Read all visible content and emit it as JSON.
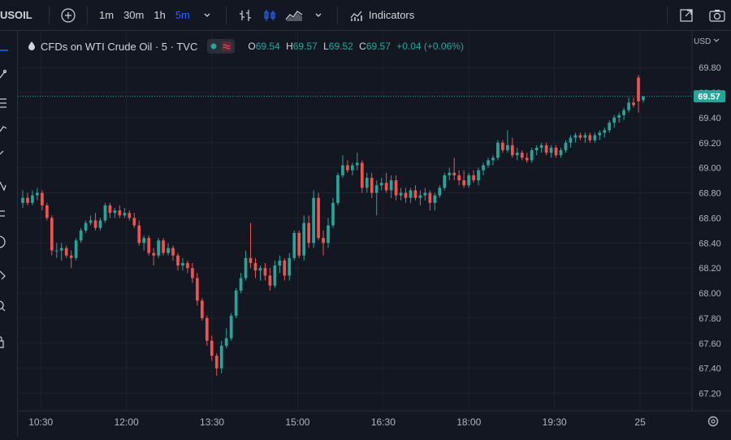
{
  "toolbar": {
    "symbol": "USOIL",
    "intervals": [
      "1m",
      "30m",
      "1h",
      "5m"
    ],
    "active_interval": "5m",
    "indicators_label": "Indicators"
  },
  "legend": {
    "title": "CFDs on WTI Crude Oil · 5 · TVC",
    "o_label": "O",
    "o": "69.54",
    "h_label": "H",
    "h": "69.57",
    "l_label": "L",
    "l": "69.52",
    "c_label": "C",
    "c": "69.57",
    "change": "+0.04 (+0.06%)"
  },
  "price_axis": {
    "currency": "USD"
  },
  "colors": {
    "up": "#26a69a",
    "down": "#ef5350",
    "background": "#131722",
    "grid": "#1e222d",
    "text": "#b2b5be",
    "accent": "#2962ff"
  },
  "chart_data": {
    "type": "candlestick",
    "ylim": [
      67.1,
      69.95
    ],
    "y_ticks": [
      67.2,
      67.4,
      67.6,
      67.8,
      68.0,
      68.2,
      68.4,
      68.6,
      68.8,
      69.0,
      69.2,
      69.4,
      69.6,
      69.8
    ],
    "x_ticks": [
      "10:30",
      "12:00",
      "13:30",
      "15:00",
      "16:30",
      "18:00",
      "19:30",
      "25"
    ],
    "last_price": "69.57",
    "candles": [
      {
        "o": 68.72,
        "h": 68.82,
        "l": 68.68,
        "c": 68.76
      },
      {
        "o": 68.76,
        "h": 68.8,
        "l": 68.7,
        "c": 68.72
      },
      {
        "o": 68.72,
        "h": 68.82,
        "l": 68.7,
        "c": 68.78
      },
      {
        "o": 68.78,
        "h": 68.84,
        "l": 68.74,
        "c": 68.8
      },
      {
        "o": 68.8,
        "h": 68.82,
        "l": 68.66,
        "c": 68.7
      },
      {
        "o": 68.7,
        "h": 68.72,
        "l": 68.58,
        "c": 68.6
      },
      {
        "o": 68.6,
        "h": 68.62,
        "l": 68.3,
        "c": 68.34
      },
      {
        "o": 68.34,
        "h": 68.4,
        "l": 68.28,
        "c": 68.34
      },
      {
        "o": 68.34,
        "h": 68.4,
        "l": 68.26,
        "c": 68.36
      },
      {
        "o": 68.36,
        "h": 68.38,
        "l": 68.28,
        "c": 68.3
      },
      {
        "o": 68.3,
        "h": 68.34,
        "l": 68.2,
        "c": 68.28
      },
      {
        "o": 68.28,
        "h": 68.44,
        "l": 68.26,
        "c": 68.42
      },
      {
        "o": 68.42,
        "h": 68.52,
        "l": 68.4,
        "c": 68.5
      },
      {
        "o": 68.5,
        "h": 68.58,
        "l": 68.48,
        "c": 68.56
      },
      {
        "o": 68.56,
        "h": 68.62,
        "l": 68.54,
        "c": 68.58
      },
      {
        "o": 68.58,
        "h": 68.64,
        "l": 68.5,
        "c": 68.52
      },
      {
        "o": 68.52,
        "h": 68.6,
        "l": 68.5,
        "c": 68.58
      },
      {
        "o": 68.58,
        "h": 68.72,
        "l": 68.56,
        "c": 68.7
      },
      {
        "o": 68.7,
        "h": 68.72,
        "l": 68.6,
        "c": 68.64
      },
      {
        "o": 68.64,
        "h": 68.68,
        "l": 68.6,
        "c": 68.66
      },
      {
        "o": 68.66,
        "h": 68.7,
        "l": 68.6,
        "c": 68.62
      },
      {
        "o": 68.62,
        "h": 68.68,
        "l": 68.6,
        "c": 68.64
      },
      {
        "o": 68.64,
        "h": 68.66,
        "l": 68.58,
        "c": 68.6
      },
      {
        "o": 68.6,
        "h": 68.64,
        "l": 68.52,
        "c": 68.54
      },
      {
        "o": 68.54,
        "h": 68.58,
        "l": 68.38,
        "c": 68.4
      },
      {
        "o": 68.4,
        "h": 68.46,
        "l": 68.34,
        "c": 68.44
      },
      {
        "o": 68.44,
        "h": 68.46,
        "l": 68.3,
        "c": 68.32
      },
      {
        "o": 68.32,
        "h": 68.36,
        "l": 68.22,
        "c": 68.3
      },
      {
        "o": 68.3,
        "h": 68.44,
        "l": 68.28,
        "c": 68.42
      },
      {
        "o": 68.42,
        "h": 68.44,
        "l": 68.3,
        "c": 68.32
      },
      {
        "o": 68.32,
        "h": 68.4,
        "l": 68.3,
        "c": 68.36
      },
      {
        "o": 68.36,
        "h": 68.38,
        "l": 68.26,
        "c": 68.3
      },
      {
        "o": 68.3,
        "h": 68.32,
        "l": 68.18,
        "c": 68.22
      },
      {
        "o": 68.22,
        "h": 68.28,
        "l": 68.18,
        "c": 68.24
      },
      {
        "o": 68.24,
        "h": 68.26,
        "l": 68.16,
        "c": 68.2
      },
      {
        "o": 68.2,
        "h": 68.24,
        "l": 68.08,
        "c": 68.12
      },
      {
        "o": 68.12,
        "h": 68.16,
        "l": 67.9,
        "c": 67.94
      },
      {
        "o": 67.94,
        "h": 67.96,
        "l": 67.78,
        "c": 67.8
      },
      {
        "o": 67.8,
        "h": 67.82,
        "l": 67.58,
        "c": 67.62
      },
      {
        "o": 67.62,
        "h": 67.66,
        "l": 67.46,
        "c": 67.5
      },
      {
        "o": 67.5,
        "h": 67.52,
        "l": 67.34,
        "c": 67.4
      },
      {
        "o": 67.4,
        "h": 67.62,
        "l": 67.36,
        "c": 67.58
      },
      {
        "o": 67.58,
        "h": 67.72,
        "l": 67.56,
        "c": 67.64
      },
      {
        "o": 67.64,
        "h": 67.84,
        "l": 67.62,
        "c": 67.82
      },
      {
        "o": 67.82,
        "h": 68.04,
        "l": 67.8,
        "c": 68.02
      },
      {
        "o": 68.02,
        "h": 68.16,
        "l": 68.0,
        "c": 68.12
      },
      {
        "o": 68.12,
        "h": 68.34,
        "l": 68.1,
        "c": 68.28
      },
      {
        "o": 68.28,
        "h": 68.56,
        "l": 68.2,
        "c": 68.24
      },
      {
        "o": 68.24,
        "h": 68.28,
        "l": 68.12,
        "c": 68.18
      },
      {
        "o": 68.18,
        "h": 68.22,
        "l": 68.1,
        "c": 68.2
      },
      {
        "o": 68.2,
        "h": 68.24,
        "l": 68.1,
        "c": 68.14
      },
      {
        "o": 68.14,
        "h": 68.2,
        "l": 68.02,
        "c": 68.06
      },
      {
        "o": 68.06,
        "h": 68.26,
        "l": 68.04,
        "c": 68.22
      },
      {
        "o": 68.22,
        "h": 68.3,
        "l": 68.16,
        "c": 68.26
      },
      {
        "o": 68.26,
        "h": 68.28,
        "l": 68.1,
        "c": 68.14
      },
      {
        "o": 68.14,
        "h": 68.32,
        "l": 68.1,
        "c": 68.28
      },
      {
        "o": 68.28,
        "h": 68.5,
        "l": 68.26,
        "c": 68.48
      },
      {
        "o": 68.48,
        "h": 68.5,
        "l": 68.28,
        "c": 68.3
      },
      {
        "o": 68.3,
        "h": 68.62,
        "l": 68.26,
        "c": 68.56
      },
      {
        "o": 68.56,
        "h": 68.62,
        "l": 68.36,
        "c": 68.4
      },
      {
        "o": 68.4,
        "h": 68.82,
        "l": 68.36,
        "c": 68.76
      },
      {
        "o": 68.76,
        "h": 68.8,
        "l": 68.42,
        "c": 68.44
      },
      {
        "o": 68.44,
        "h": 68.5,
        "l": 68.3,
        "c": 68.4
      },
      {
        "o": 68.4,
        "h": 68.6,
        "l": 68.36,
        "c": 68.54
      },
      {
        "o": 68.54,
        "h": 68.76,
        "l": 68.52,
        "c": 68.72
      },
      {
        "o": 68.72,
        "h": 68.96,
        "l": 68.7,
        "c": 68.94
      },
      {
        "o": 68.94,
        "h": 69.1,
        "l": 68.92,
        "c": 69.02
      },
      {
        "o": 69.02,
        "h": 69.06,
        "l": 68.96,
        "c": 68.98
      },
      {
        "o": 68.98,
        "h": 69.04,
        "l": 68.94,
        "c": 69.02
      },
      {
        "o": 69.02,
        "h": 69.12,
        "l": 68.98,
        "c": 69.04
      },
      {
        "o": 69.04,
        "h": 69.06,
        "l": 68.8,
        "c": 68.84
      },
      {
        "o": 68.84,
        "h": 68.96,
        "l": 68.8,
        "c": 68.92
      },
      {
        "o": 68.92,
        "h": 68.96,
        "l": 68.76,
        "c": 68.8
      },
      {
        "o": 68.8,
        "h": 68.9,
        "l": 68.62,
        "c": 68.86
      },
      {
        "o": 68.86,
        "h": 68.92,
        "l": 68.82,
        "c": 68.88
      },
      {
        "o": 68.88,
        "h": 68.96,
        "l": 68.8,
        "c": 68.82
      },
      {
        "o": 68.82,
        "h": 68.94,
        "l": 68.76,
        "c": 68.9
      },
      {
        "o": 68.9,
        "h": 68.94,
        "l": 68.74,
        "c": 68.78
      },
      {
        "o": 68.78,
        "h": 68.84,
        "l": 68.74,
        "c": 68.8
      },
      {
        "o": 68.8,
        "h": 68.84,
        "l": 68.72,
        "c": 68.76
      },
      {
        "o": 68.76,
        "h": 68.84,
        "l": 68.72,
        "c": 68.82
      },
      {
        "o": 68.82,
        "h": 68.86,
        "l": 68.74,
        "c": 68.76
      },
      {
        "o": 68.76,
        "h": 68.82,
        "l": 68.7,
        "c": 68.78
      },
      {
        "o": 68.78,
        "h": 68.84,
        "l": 68.74,
        "c": 68.8
      },
      {
        "o": 68.8,
        "h": 68.82,
        "l": 68.66,
        "c": 68.72
      },
      {
        "o": 68.72,
        "h": 68.8,
        "l": 68.66,
        "c": 68.78
      },
      {
        "o": 68.78,
        "h": 68.86,
        "l": 68.76,
        "c": 68.84
      },
      {
        "o": 68.84,
        "h": 68.96,
        "l": 68.82,
        "c": 68.94
      },
      {
        "o": 68.94,
        "h": 69.0,
        "l": 68.9,
        "c": 68.96
      },
      {
        "o": 68.96,
        "h": 69.08,
        "l": 68.9,
        "c": 68.94
      },
      {
        "o": 68.94,
        "h": 68.98,
        "l": 68.86,
        "c": 68.9
      },
      {
        "o": 68.9,
        "h": 68.98,
        "l": 68.84,
        "c": 68.86
      },
      {
        "o": 68.86,
        "h": 68.96,
        "l": 68.84,
        "c": 68.94
      },
      {
        "o": 68.94,
        "h": 68.98,
        "l": 68.88,
        "c": 68.9
      },
      {
        "o": 68.9,
        "h": 69.0,
        "l": 68.86,
        "c": 68.98
      },
      {
        "o": 68.98,
        "h": 69.04,
        "l": 68.94,
        "c": 69.02
      },
      {
        "o": 69.02,
        "h": 69.08,
        "l": 69.0,
        "c": 69.06
      },
      {
        "o": 69.06,
        "h": 69.1,
        "l": 69.02,
        "c": 69.08
      },
      {
        "o": 69.08,
        "h": 69.22,
        "l": 69.06,
        "c": 69.2
      },
      {
        "o": 69.2,
        "h": 69.22,
        "l": 69.12,
        "c": 69.14
      },
      {
        "o": 69.14,
        "h": 69.3,
        "l": 69.12,
        "c": 69.18
      },
      {
        "o": 69.18,
        "h": 69.24,
        "l": 69.08,
        "c": 69.1
      },
      {
        "o": 69.1,
        "h": 69.16,
        "l": 69.06,
        "c": 69.12
      },
      {
        "o": 69.12,
        "h": 69.14,
        "l": 69.06,
        "c": 69.08
      },
      {
        "o": 69.08,
        "h": 69.12,
        "l": 69.04,
        "c": 69.06
      },
      {
        "o": 69.06,
        "h": 69.16,
        "l": 69.04,
        "c": 69.14
      },
      {
        "o": 69.14,
        "h": 69.18,
        "l": 69.1,
        "c": 69.16
      },
      {
        "o": 69.16,
        "h": 69.2,
        "l": 69.12,
        "c": 69.18
      },
      {
        "o": 69.18,
        "h": 69.2,
        "l": 69.1,
        "c": 69.12
      },
      {
        "o": 69.12,
        "h": 69.18,
        "l": 69.08,
        "c": 69.16
      },
      {
        "o": 69.16,
        "h": 69.18,
        "l": 69.08,
        "c": 69.1
      },
      {
        "o": 69.1,
        "h": 69.16,
        "l": 69.08,
        "c": 69.14
      },
      {
        "o": 69.14,
        "h": 69.22,
        "l": 69.12,
        "c": 69.2
      },
      {
        "o": 69.2,
        "h": 69.26,
        "l": 69.16,
        "c": 69.24
      },
      {
        "o": 69.24,
        "h": 69.28,
        "l": 69.2,
        "c": 69.26
      },
      {
        "o": 69.26,
        "h": 69.28,
        "l": 69.22,
        "c": 69.24
      },
      {
        "o": 69.24,
        "h": 69.28,
        "l": 69.2,
        "c": 69.26
      },
      {
        "o": 69.26,
        "h": 69.28,
        "l": 69.2,
        "c": 69.22
      },
      {
        "o": 69.22,
        "h": 69.28,
        "l": 69.2,
        "c": 69.26
      },
      {
        "o": 69.26,
        "h": 69.3,
        "l": 69.22,
        "c": 69.28
      },
      {
        "o": 69.28,
        "h": 69.32,
        "l": 69.24,
        "c": 69.3
      },
      {
        "o": 69.3,
        "h": 69.38,
        "l": 69.28,
        "c": 69.36
      },
      {
        "o": 69.36,
        "h": 69.42,
        "l": 69.32,
        "c": 69.4
      },
      {
        "o": 69.4,
        "h": 69.44,
        "l": 69.36,
        "c": 69.42
      },
      {
        "o": 69.42,
        "h": 69.48,
        "l": 69.38,
        "c": 69.46
      },
      {
        "o": 69.46,
        "h": 69.56,
        "l": 69.44,
        "c": 69.52
      },
      {
        "o": 69.52,
        "h": 69.56,
        "l": 69.48,
        "c": 69.5
      },
      {
        "o": 69.72,
        "h": 69.74,
        "l": 69.44,
        "c": 69.53
      },
      {
        "o": 69.54,
        "h": 69.57,
        "l": 69.52,
        "c": 69.57
      }
    ]
  }
}
